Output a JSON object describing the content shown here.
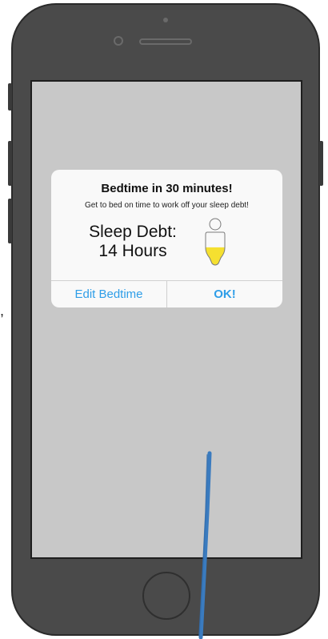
{
  "alert": {
    "title": "Bedtime in 30 minutes!",
    "subtitle": "Get to bed on time to work off your sleep debt!",
    "debt_line1": "Sleep Debt:",
    "debt_line2": "14 Hours",
    "debt_icon": "sleep-battery-icon",
    "debt_fill_fraction": 0.55,
    "buttons": {
      "edit_label": "Edit Bedtime",
      "ok_label": "OK!"
    }
  },
  "colors": {
    "button_text": "#2f9ee8",
    "screen_bg": "#c8c8c8",
    "phone_body": "#4a4a4a",
    "debt_fill": "#f5e030",
    "annotation_stroke": "#3a7bbf"
  },
  "margin_note": ","
}
